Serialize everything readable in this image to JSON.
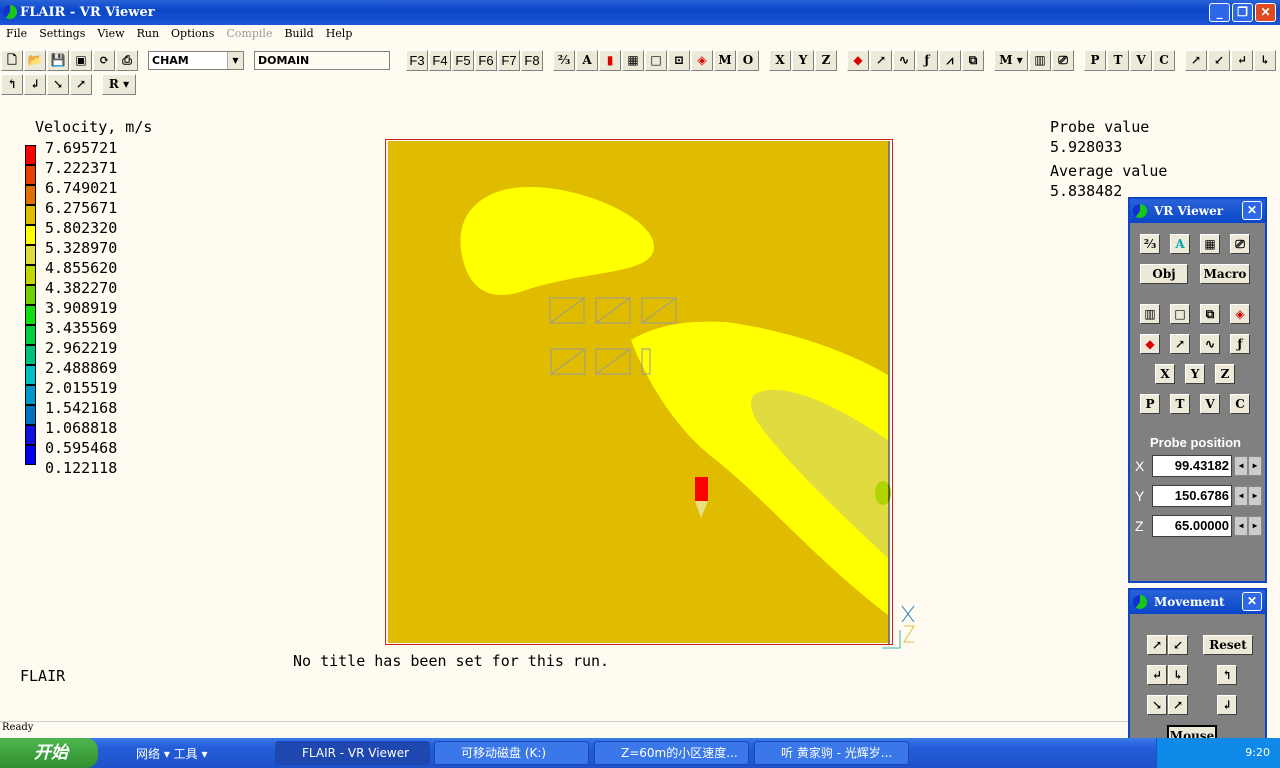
{
  "window": {
    "title": "FLAIR - VR Viewer"
  },
  "menu": [
    {
      "label": "File",
      "enabled": true
    },
    {
      "label": "Settings",
      "enabled": true
    },
    {
      "label": "View",
      "enabled": true
    },
    {
      "label": "Run",
      "enabled": true
    },
    {
      "label": "Options",
      "enabled": true
    },
    {
      "label": "Compile",
      "enabled": false
    },
    {
      "label": "Build",
      "enabled": true
    },
    {
      "label": "Help",
      "enabled": true
    }
  ],
  "toolbar": {
    "file_icons": [
      "new-file-icon",
      "open-folder-icon",
      "save-icon",
      "color-icon",
      "refresh-icon",
      "print-icon"
    ],
    "combo1": "CHAM",
    "combo2": "DOMAIN",
    "fkeys": [
      "F3",
      "F4",
      "F5",
      "F6",
      "F7",
      "F8"
    ],
    "group1": [
      "axes-icon",
      "mesh-a-icon",
      "probe-icon",
      "grid-icon",
      "box-icon",
      "object-icon",
      "hide-object-icon"
    ],
    "mo": [
      "M",
      "O"
    ],
    "xyz": [
      "X",
      "Y",
      "Z"
    ],
    "group2": [
      "contour-icon",
      "vector-icon",
      "streamline-icon",
      "isosurface-icon",
      "graph-icon",
      "cube-icon"
    ],
    "m_select": "M",
    "group3": [
      "film-icon",
      "camera-icon"
    ],
    "ptvc": [
      "P",
      "T",
      "V",
      "C"
    ],
    "arrows": [
      "zoom-in-icon",
      "zoom-out-icon",
      "rotate-left-icon",
      "rotate-right-icon"
    ],
    "row2": [
      "up-icon",
      "down-icon",
      "tilt-left-icon",
      "tilt-right-icon"
    ],
    "r_select": "R"
  },
  "legend": {
    "title": "Velocity, m/s",
    "values": [
      "7.695721",
      "7.222371",
      "6.749021",
      "6.275671",
      "5.802320",
      "5.328970",
      "4.855620",
      "4.382270",
      "3.908919",
      "3.435569",
      "2.962219",
      "2.488869",
      "2.015519",
      "1.542168",
      "1.068818",
      "0.595468",
      "0.122118"
    ],
    "colors": [
      "#FF0000",
      "#E84000",
      "#E07000",
      "#E0BC00",
      "#FFFF00",
      "#E0DC40",
      "#C0D800",
      "#70D000",
      "#10E010",
      "#00D040",
      "#00C080",
      "#00C0C0",
      "#0098C8",
      "#0070C0",
      "#1010E0",
      "#0000F0"
    ]
  },
  "probe": {
    "label": "Probe value",
    "value": "5.928033",
    "avg_label": "Average value",
    "avg_value": "5.838482"
  },
  "plot": {
    "run_title": "No title has been set for this run.",
    "axis_x": "X",
    "axis_z": "Z",
    "colors": {
      "background": "#E0BC00",
      "band": "#FFFF00",
      "inner": "#E0DC40",
      "spot": "#B0D400"
    }
  },
  "footer_label": "FLAIR",
  "vr_panel": {
    "title": "VR Viewer",
    "obj": "Obj",
    "macro": "Macro",
    "xyz": [
      "X",
      "Y",
      "Z"
    ],
    "ptvc": [
      "P",
      "T",
      "V",
      "C"
    ],
    "probe_title": "Probe position",
    "x": "99.43182",
    "y": "150.6786",
    "z": "65.00000"
  },
  "movement": {
    "title": "Movement",
    "reset": "Reset",
    "mouse": "Mouse"
  },
  "status": "Ready",
  "taskbar": {
    "start": "开始",
    "quick": "网络 ▾ 工具 ▾",
    "tasks": [
      "FLAIR - VR Viewer",
      "可移动磁盘 (K:)",
      "Z=60m的小区速度...",
      "听  黄家驹 - 光辉岁..."
    ],
    "clock": "9:20"
  }
}
